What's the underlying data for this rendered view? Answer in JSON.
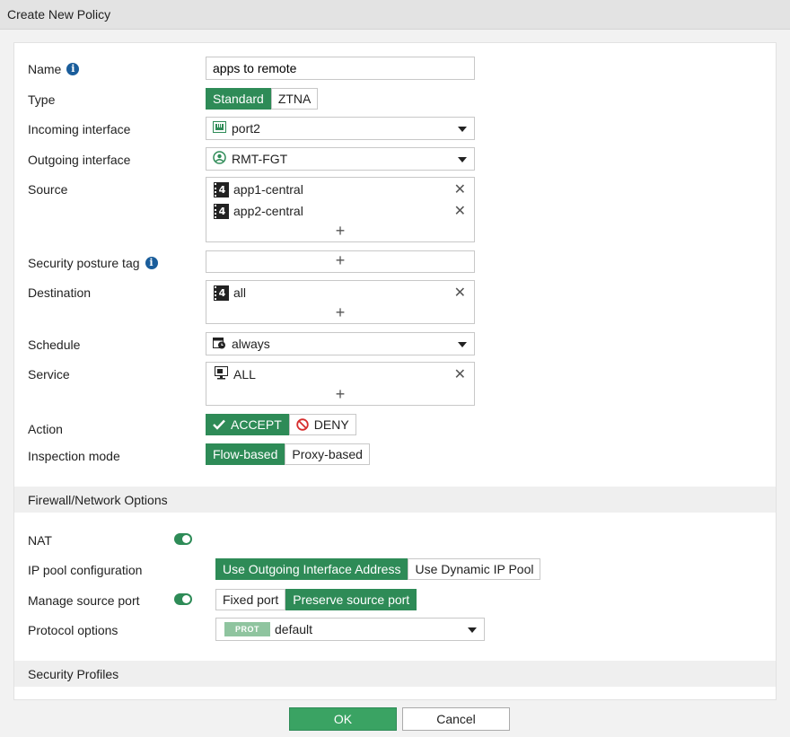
{
  "window": {
    "title": "Create New Policy"
  },
  "form": {
    "name": {
      "label": "Name",
      "value": "apps to remote"
    },
    "type": {
      "label": "Type",
      "options": [
        "Standard",
        "ZTNA"
      ],
      "selected": "Standard"
    },
    "incoming": {
      "label": "Incoming interface",
      "value": "port2"
    },
    "outgoing": {
      "label": "Outgoing interface",
      "value": "RMT-FGT"
    },
    "source": {
      "label": "Source",
      "items": [
        "app1-central",
        "app2-central"
      ],
      "add": "+"
    },
    "posture": {
      "label": "Security posture tag",
      "add": "+"
    },
    "destination": {
      "label": "Destination",
      "items": [
        "all"
      ],
      "add": "+"
    },
    "schedule": {
      "label": "Schedule",
      "value": "always"
    },
    "service": {
      "label": "Service",
      "items": [
        "ALL"
      ],
      "add": "+"
    },
    "action": {
      "label": "Action",
      "accept": "ACCEPT",
      "deny": "DENY",
      "selected": "ACCEPT"
    },
    "inspection": {
      "label": "Inspection mode",
      "options": [
        "Flow-based",
        "Proxy-based"
      ],
      "selected": "Flow-based"
    }
  },
  "firewall": {
    "header": "Firewall/Network Options",
    "nat": {
      "label": "NAT",
      "enabled": true
    },
    "ippool": {
      "label": "IP pool configuration",
      "options": [
        "Use Outgoing Interface Address",
        "Use Dynamic IP Pool"
      ],
      "selected": "Use Outgoing Interface Address"
    },
    "srcport": {
      "label": "Manage source port",
      "enabled": true,
      "options": [
        "Fixed port",
        "Preserve source port"
      ],
      "selected": "Preserve source port"
    },
    "protocol": {
      "label": "Protocol options",
      "badge": "PROT",
      "value": "default"
    }
  },
  "security": {
    "header": "Security Profiles"
  },
  "footer": {
    "ok": "OK",
    "cancel": "Cancel"
  },
  "colors": {
    "accent": "#2e8b57",
    "ok_button": "#3aa363",
    "info": "#1a5d9b"
  },
  "icons": {
    "incoming": "port-interface-icon",
    "outgoing": "tunnel-interface-icon",
    "address": "address-ipv4-icon",
    "schedule": "schedule-clock-icon",
    "service": "service-monitor-icon",
    "remove": "close-icon",
    "add": "plus-icon",
    "info": "info-icon",
    "accept": "checkmark-icon",
    "deny": "deny-icon"
  }
}
